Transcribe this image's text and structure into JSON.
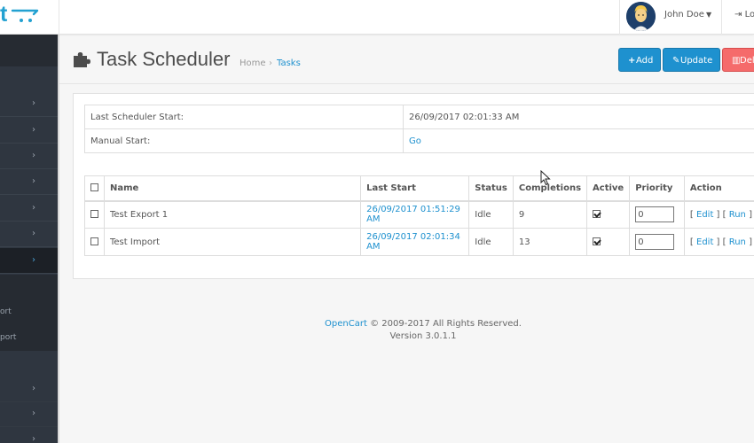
{
  "header": {
    "logo_text": "t",
    "user_name": "John Doe",
    "logout_label": "Lo"
  },
  "sidebar": {
    "sub_items": [
      "ort",
      "port"
    ]
  },
  "page": {
    "title": "Task Scheduler",
    "breadcrumb": {
      "home": "Home",
      "separator": "›",
      "current": "Tasks"
    },
    "buttons": {
      "add": "Add",
      "update": "Update",
      "delete": "Dele"
    }
  },
  "info": {
    "last_start_label": "Last Scheduler Start:",
    "last_start_value": "26/09/2017 02:01:33 AM",
    "manual_start_label": "Manual Start:",
    "manual_start_link": "Go"
  },
  "tasks": {
    "columns": {
      "name": "Name",
      "last_start": "Last Start",
      "status": "Status",
      "completions": "Completions",
      "active": "Active",
      "priority": "Priority",
      "action": "Action"
    },
    "rows": [
      {
        "name": "Test Export 1",
        "last_start": "26/09/2017 01:51:29 AM",
        "status": "Idle",
        "completions": "9",
        "active": true,
        "priority": "0",
        "action_edit": "Edit",
        "action_run": "Run"
      },
      {
        "name": "Test Import",
        "last_start": "26/09/2017 02:01:34 AM",
        "status": "Idle",
        "completions": "13",
        "active": true,
        "priority": "0",
        "action_edit": "Edit",
        "action_run": "Run"
      }
    ]
  },
  "footer": {
    "brand": "OpenCart",
    "rights": "© 2009-2017 All Rights Reserved.",
    "version": "Version 3.0.1.1"
  },
  "colors": {
    "accent": "#1e91cf",
    "danger": "#f56b6b",
    "sidebar": "#2f3640"
  }
}
